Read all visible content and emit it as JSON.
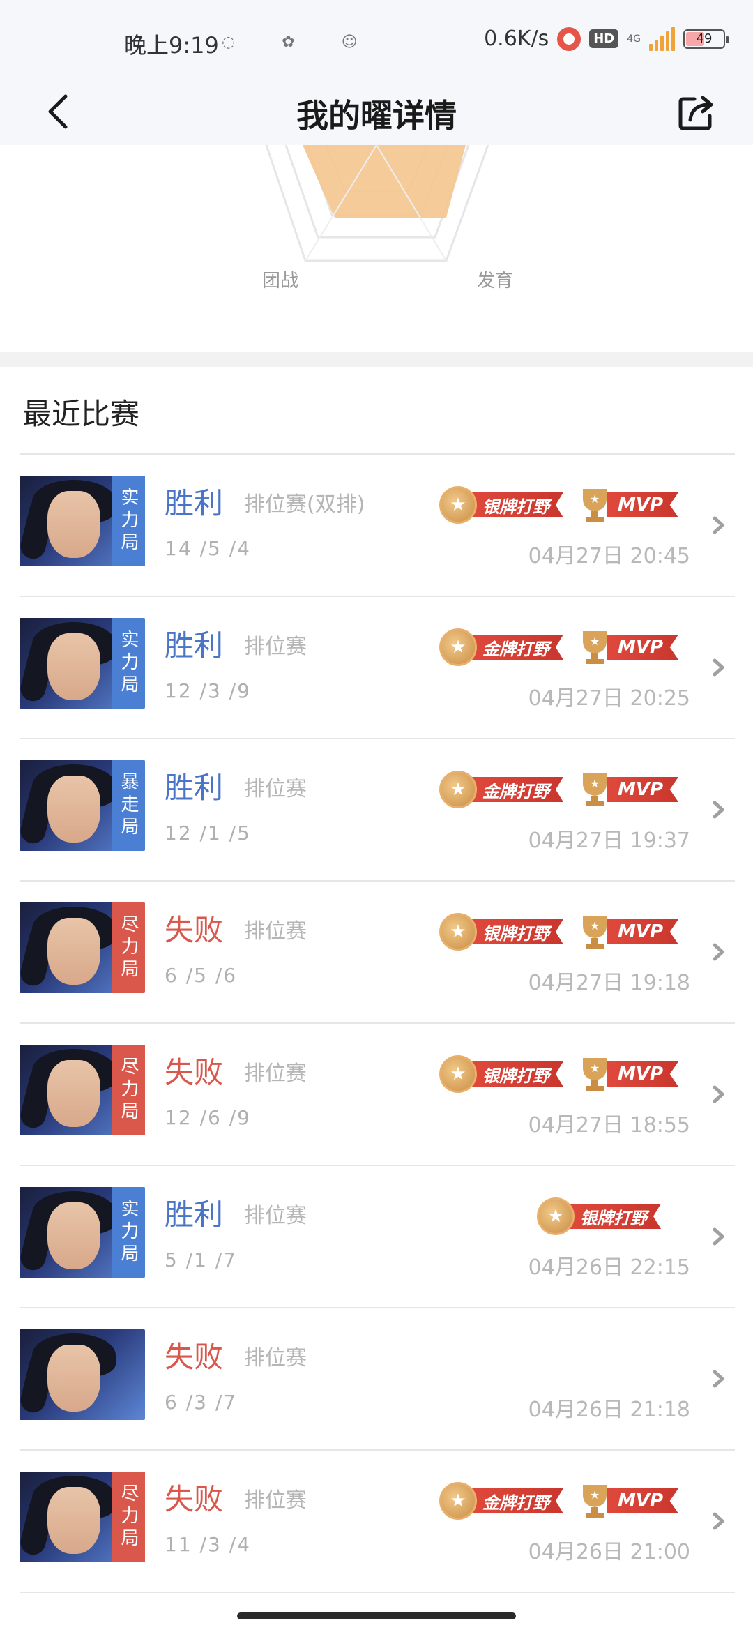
{
  "status_bar": {
    "time": "晚上9:19",
    "speed": "0.6K/s",
    "hd": "HD",
    "network": "4G",
    "battery": "49"
  },
  "nav": {
    "title": "我的曜详情"
  },
  "radar": {
    "label_left": "团战",
    "label_right": "发育"
  },
  "section": {
    "title": "最近比赛"
  },
  "colors": {
    "win": "#4a74c6",
    "loss": "#d9574b",
    "badge_win": "#4a7fd4",
    "badge_loss": "#d9574b"
  },
  "matches": [
    {
      "badge": "实力局",
      "result": "胜利",
      "mode": "排位赛(双排)",
      "kda": "14 /5 /4",
      "date": "04月27日  20:45",
      "medal": "银牌打野",
      "mvp": "MVP"
    },
    {
      "badge": "实力局",
      "result": "胜利",
      "mode": "排位赛",
      "kda": "12 /3 /9",
      "date": "04月27日  20:25",
      "medal": "金牌打野",
      "mvp": "MVP"
    },
    {
      "badge": "暴走局",
      "result": "胜利",
      "mode": "排位赛",
      "kda": "12 /1 /5",
      "date": "04月27日  19:37",
      "medal": "金牌打野",
      "mvp": "MVP"
    },
    {
      "badge": "尽力局",
      "result": "失败",
      "mode": "排位赛",
      "kda": "6 /5 /6",
      "date": "04月27日  19:18",
      "medal": "银牌打野",
      "mvp": "MVP"
    },
    {
      "badge": "尽力局",
      "result": "失败",
      "mode": "排位赛",
      "kda": "12 /6 /9",
      "date": "04月27日  18:55",
      "medal": "银牌打野",
      "mvp": "MVP"
    },
    {
      "badge": "实力局",
      "result": "胜利",
      "mode": "排位赛",
      "kda": "5 /1 /7",
      "date": "04月26日  22:15",
      "medal": "银牌打野",
      "mvp": ""
    },
    {
      "badge": "",
      "result": "失败",
      "mode": "排位赛",
      "kda": "6 /3 /7",
      "date": "04月26日  21:18",
      "medal": "",
      "mvp": ""
    },
    {
      "badge": "尽力局",
      "result": "失败",
      "mode": "排位赛",
      "kda": "11 /3 /4",
      "date": "04月26日  21:00",
      "medal": "金牌打野",
      "mvp": "MVP"
    }
  ]
}
